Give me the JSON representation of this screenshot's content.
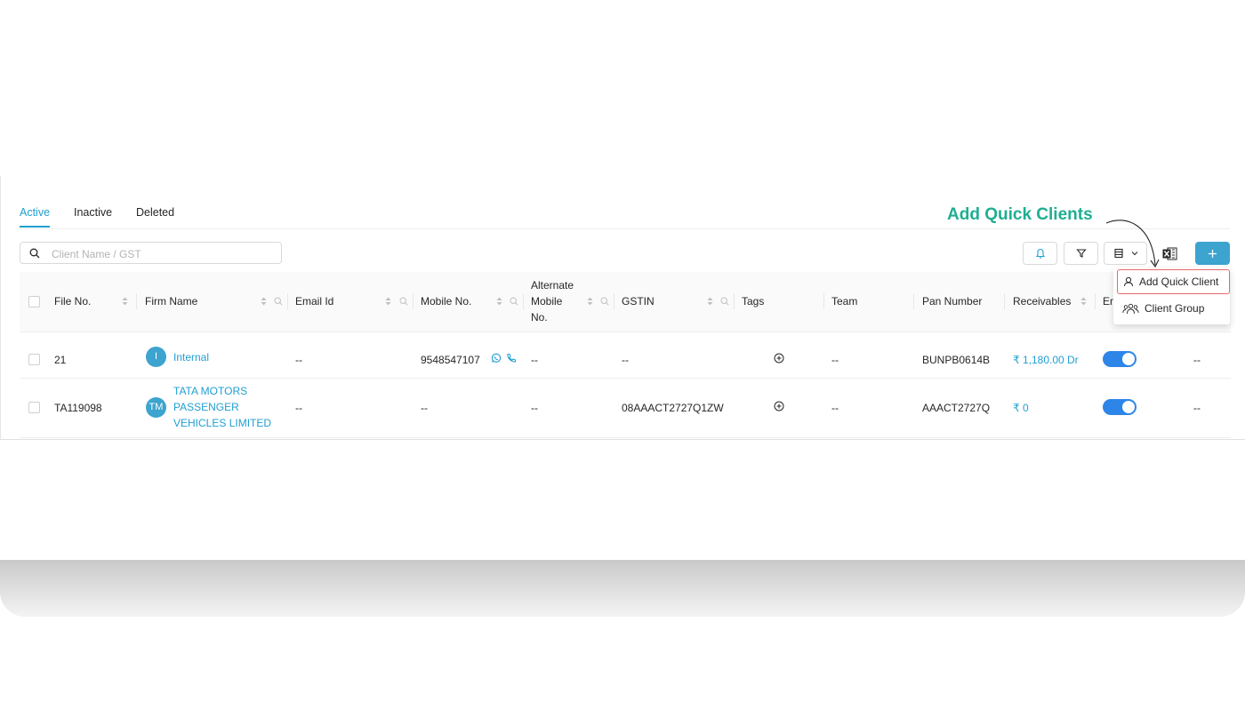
{
  "tabs": [
    {
      "label": "Active",
      "active": true
    },
    {
      "label": "Inactive",
      "active": false
    },
    {
      "label": "Deleted",
      "active": false
    }
  ],
  "search": {
    "placeholder": "Client Name / GST",
    "value": ""
  },
  "toolbar": {
    "icons": [
      "bell-icon",
      "filter-icon",
      "columns-icon",
      "excel-icon",
      "plus-icon"
    ]
  },
  "table": {
    "headers": {
      "file_no": "File No.",
      "firm_name": "Firm Name",
      "email_id": "Email Id",
      "mobile_no": "Mobile No.",
      "alt_mobile_1": "Alternate",
      "alt_mobile_2": "Mobile",
      "alt_mobile_3": "No.",
      "gstin": "GSTIN",
      "tags": "Tags",
      "team": "Team",
      "pan_number": "Pan Number",
      "receivables": "Receivables",
      "enable": "En"
    },
    "rows": [
      {
        "file_no": "21",
        "avatar": "I",
        "firm_name_1": "Internal",
        "email": "--",
        "mobile": "9548547107",
        "alt_mobile": "--",
        "gstin": "--",
        "team": "--",
        "pan": "BUNPB0614B",
        "receivables": "₹ 1,180.00 Dr",
        "enabled": true,
        "last": "--"
      },
      {
        "file_no": "TA119098",
        "avatar": "TM",
        "firm_name_1": "TATA MOTORS",
        "firm_name_2": "PASSENGER",
        "firm_name_3": "VEHICLES LIMITED",
        "email": "--",
        "mobile": "--",
        "alt_mobile": "--",
        "gstin": "08AAACT2727Q1ZW",
        "team": "--",
        "pan": "AAACT2727Q",
        "receivables": "₹ 0",
        "enabled": true,
        "last": "--"
      }
    ]
  },
  "dropdown": {
    "items": [
      {
        "label": "Add Quick Client",
        "icon": "user-icon",
        "highlighted": true
      },
      {
        "label": "Client Group",
        "icon": "group-icon",
        "highlighted": false
      }
    ]
  },
  "annotation": {
    "text": "Add Quick Clients"
  },
  "colors": {
    "accent": "#1f9fd1",
    "primary_button": "#3da3cf",
    "toggle": "#2e85e8",
    "annotation": "#1fae91",
    "highlight_border": "#e86868"
  }
}
